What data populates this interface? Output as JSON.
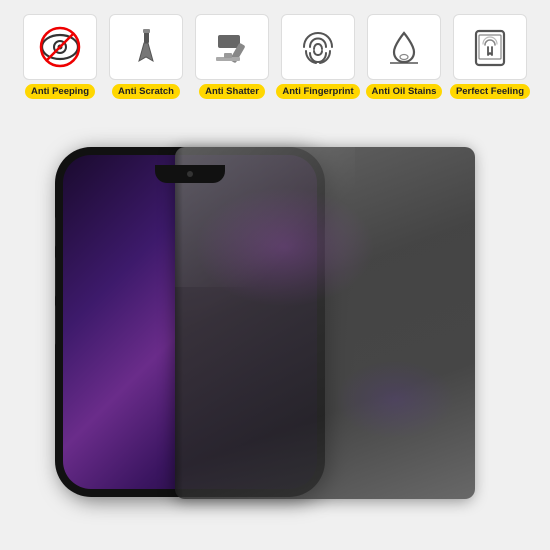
{
  "features": [
    {
      "id": "anti-peeping",
      "label": "Anti Peeping",
      "icon": "eye-slash"
    },
    {
      "id": "anti-scratch",
      "label": "Anti Scratch",
      "icon": "scratch"
    },
    {
      "id": "anti-shatter",
      "label": "Anti Shatter",
      "icon": "hammer"
    },
    {
      "id": "anti-fingerprint",
      "label": "Anti Fingerprint",
      "icon": "fingerprint"
    },
    {
      "id": "anti-oil-stains",
      "label": "Anti Oil Stains",
      "icon": "water-drop"
    },
    {
      "id": "perfect-feeling",
      "label": "Perfect Feeling",
      "icon": "touch"
    }
  ]
}
